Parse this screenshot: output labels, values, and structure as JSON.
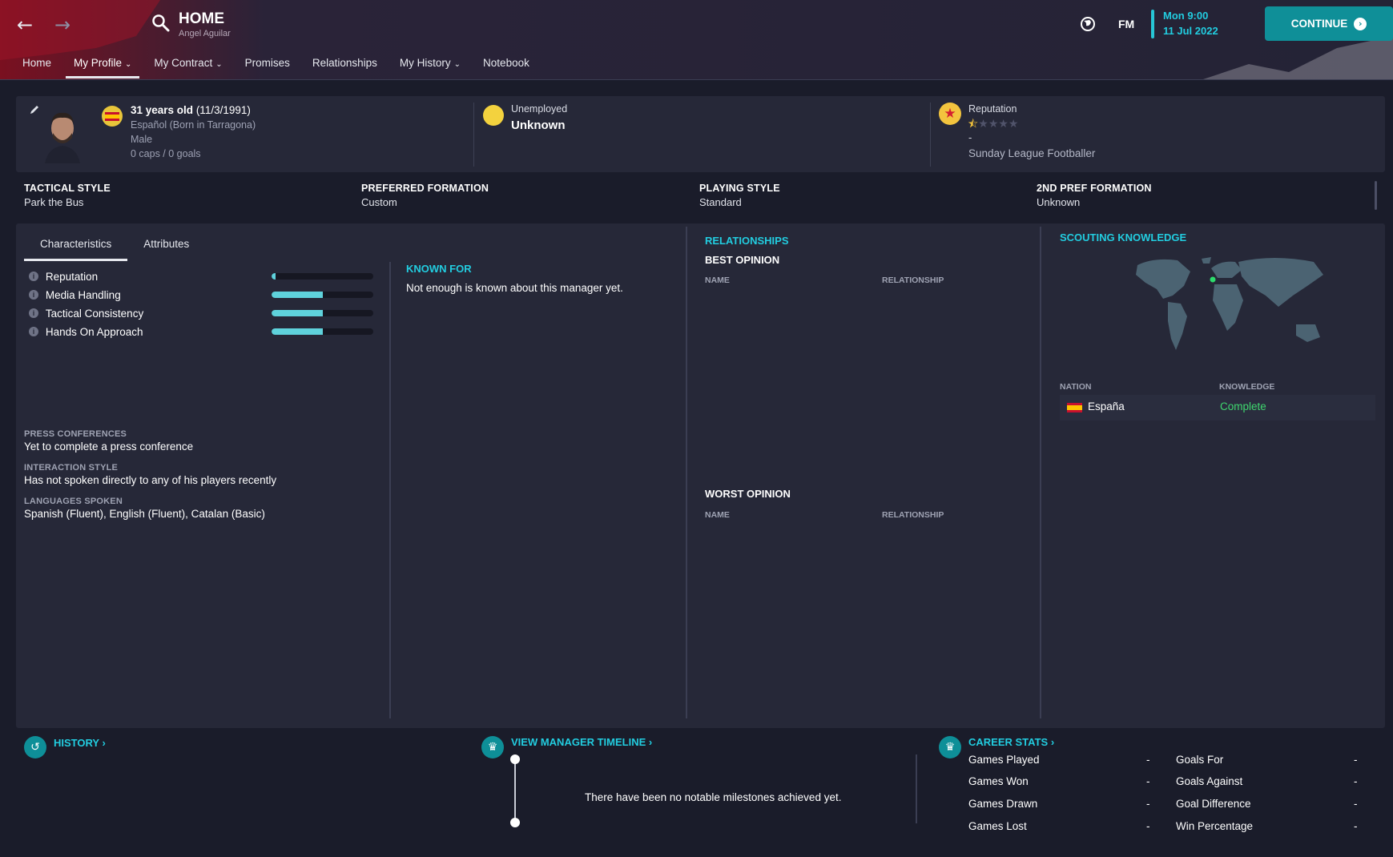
{
  "header": {
    "title": "HOME",
    "subtitle": "Angel Aguilar",
    "fm_logo": "FM",
    "time": "Mon 9:00",
    "date": "11 Jul 2022",
    "continue_label": "CONTINUE"
  },
  "tabs": [
    {
      "label": "Home"
    },
    {
      "label": "My Profile"
    },
    {
      "label": "My Contract"
    },
    {
      "label": "Promises"
    },
    {
      "label": "Relationships"
    },
    {
      "label": "My History"
    },
    {
      "label": "Notebook"
    }
  ],
  "active_tab": "My Profile",
  "profile": {
    "age": "31 years old",
    "dob": "(11/3/1991)",
    "nationality": "Español (Born in Tarragona)",
    "gender": "Male",
    "caps": "0 caps / 0 goals",
    "status_label": "Unemployed",
    "status_value": "Unknown",
    "reputation_label": "Reputation",
    "reputation_stars": 0.5,
    "reputation_max": 5,
    "reputation_dash": "-",
    "reputation_level": "Sunday League Footballer"
  },
  "style": {
    "tactical_style_h": "TACTICAL STYLE",
    "tactical_style_v": "Park the Bus",
    "pref_formation_h": "PREFERRED FORMATION",
    "pref_formation_v": "Custom",
    "playing_style_h": "PLAYING STYLE",
    "playing_style_v": "Standard",
    "second_pref_h": "2ND PREF FORMATION",
    "second_pref_v": "Unknown"
  },
  "subtabs": [
    {
      "label": "Characteristics"
    },
    {
      "label": "Attributes"
    }
  ],
  "characteristics": [
    {
      "name": "Reputation",
      "level": 0.04
    },
    {
      "name": "Media Handling",
      "level": 0.5
    },
    {
      "name": "Tactical Consistency",
      "level": 0.5
    },
    {
      "name": "Hands On Approach",
      "level": 0.5
    }
  ],
  "details": {
    "press_h": "PRESS CONFERENCES",
    "press_v": "Yet to complete a press conference",
    "interaction_h": "INTERACTION STYLE",
    "interaction_v": "Has not spoken directly to any of his players recently",
    "languages_h": "LANGUAGES SPOKEN",
    "languages_v": "Spanish (Fluent), English (Fluent), Catalan (Basic)"
  },
  "known_for": {
    "title": "KNOWN FOR",
    "text": "Not enough is known about this manager yet."
  },
  "relationships": {
    "title": "RELATIONSHIPS",
    "best": "BEST OPINION",
    "worst": "WORST OPINION",
    "col_name": "NAME",
    "col_rel": "RELATIONSHIP"
  },
  "scouting": {
    "title": "SCOUTING KNOWLEDGE",
    "col_nation": "NATION",
    "col_knowledge": "KNOWLEDGE",
    "nation": "España",
    "knowledge": "Complete"
  },
  "bottom": {
    "history": "HISTORY",
    "timeline": "VIEW MANAGER TIMELINE",
    "no_milestones": "There have been no notable milestones achieved yet.",
    "career": "CAREER STATS",
    "stats_left": [
      {
        "label": "Games Played",
        "value": "-"
      },
      {
        "label": "Games Won",
        "value": "-"
      },
      {
        "label": "Games Drawn",
        "value": "-"
      },
      {
        "label": "Games Lost",
        "value": "-"
      }
    ],
    "stats_right": [
      {
        "label": "Goals For",
        "value": "-"
      },
      {
        "label": "Goals Against",
        "value": "-"
      },
      {
        "label": "Goal Difference",
        "value": "-"
      },
      {
        "label": "Win Percentage",
        "value": "-"
      }
    ]
  },
  "colors": {
    "accent": "#22cde0",
    "continue_bg": "#0f8f98",
    "complete": "#3fd86f"
  }
}
